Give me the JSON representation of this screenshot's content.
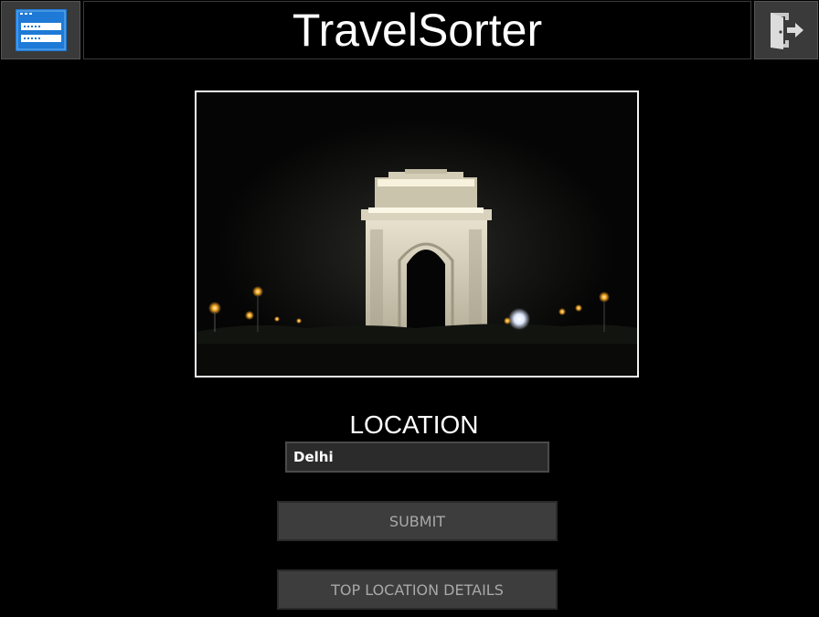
{
  "app": {
    "title": "TravelSorter"
  },
  "header": {
    "menu_icon": "login-form-icon",
    "exit_icon": "exit-door-icon"
  },
  "photo": {
    "subject": "India Gate at night"
  },
  "location": {
    "label": "LOCATION",
    "value": "Delhi"
  },
  "buttons": {
    "submit": "SUBMIT",
    "top_details": "TOP LOCATION DETAILS"
  },
  "colors": {
    "background": "#000000",
    "button_bg": "#3d3d3d",
    "button_text": "#a8a8a8",
    "menu_icon_blue": "#1e7ad6",
    "frame": "#f2f2f2"
  }
}
